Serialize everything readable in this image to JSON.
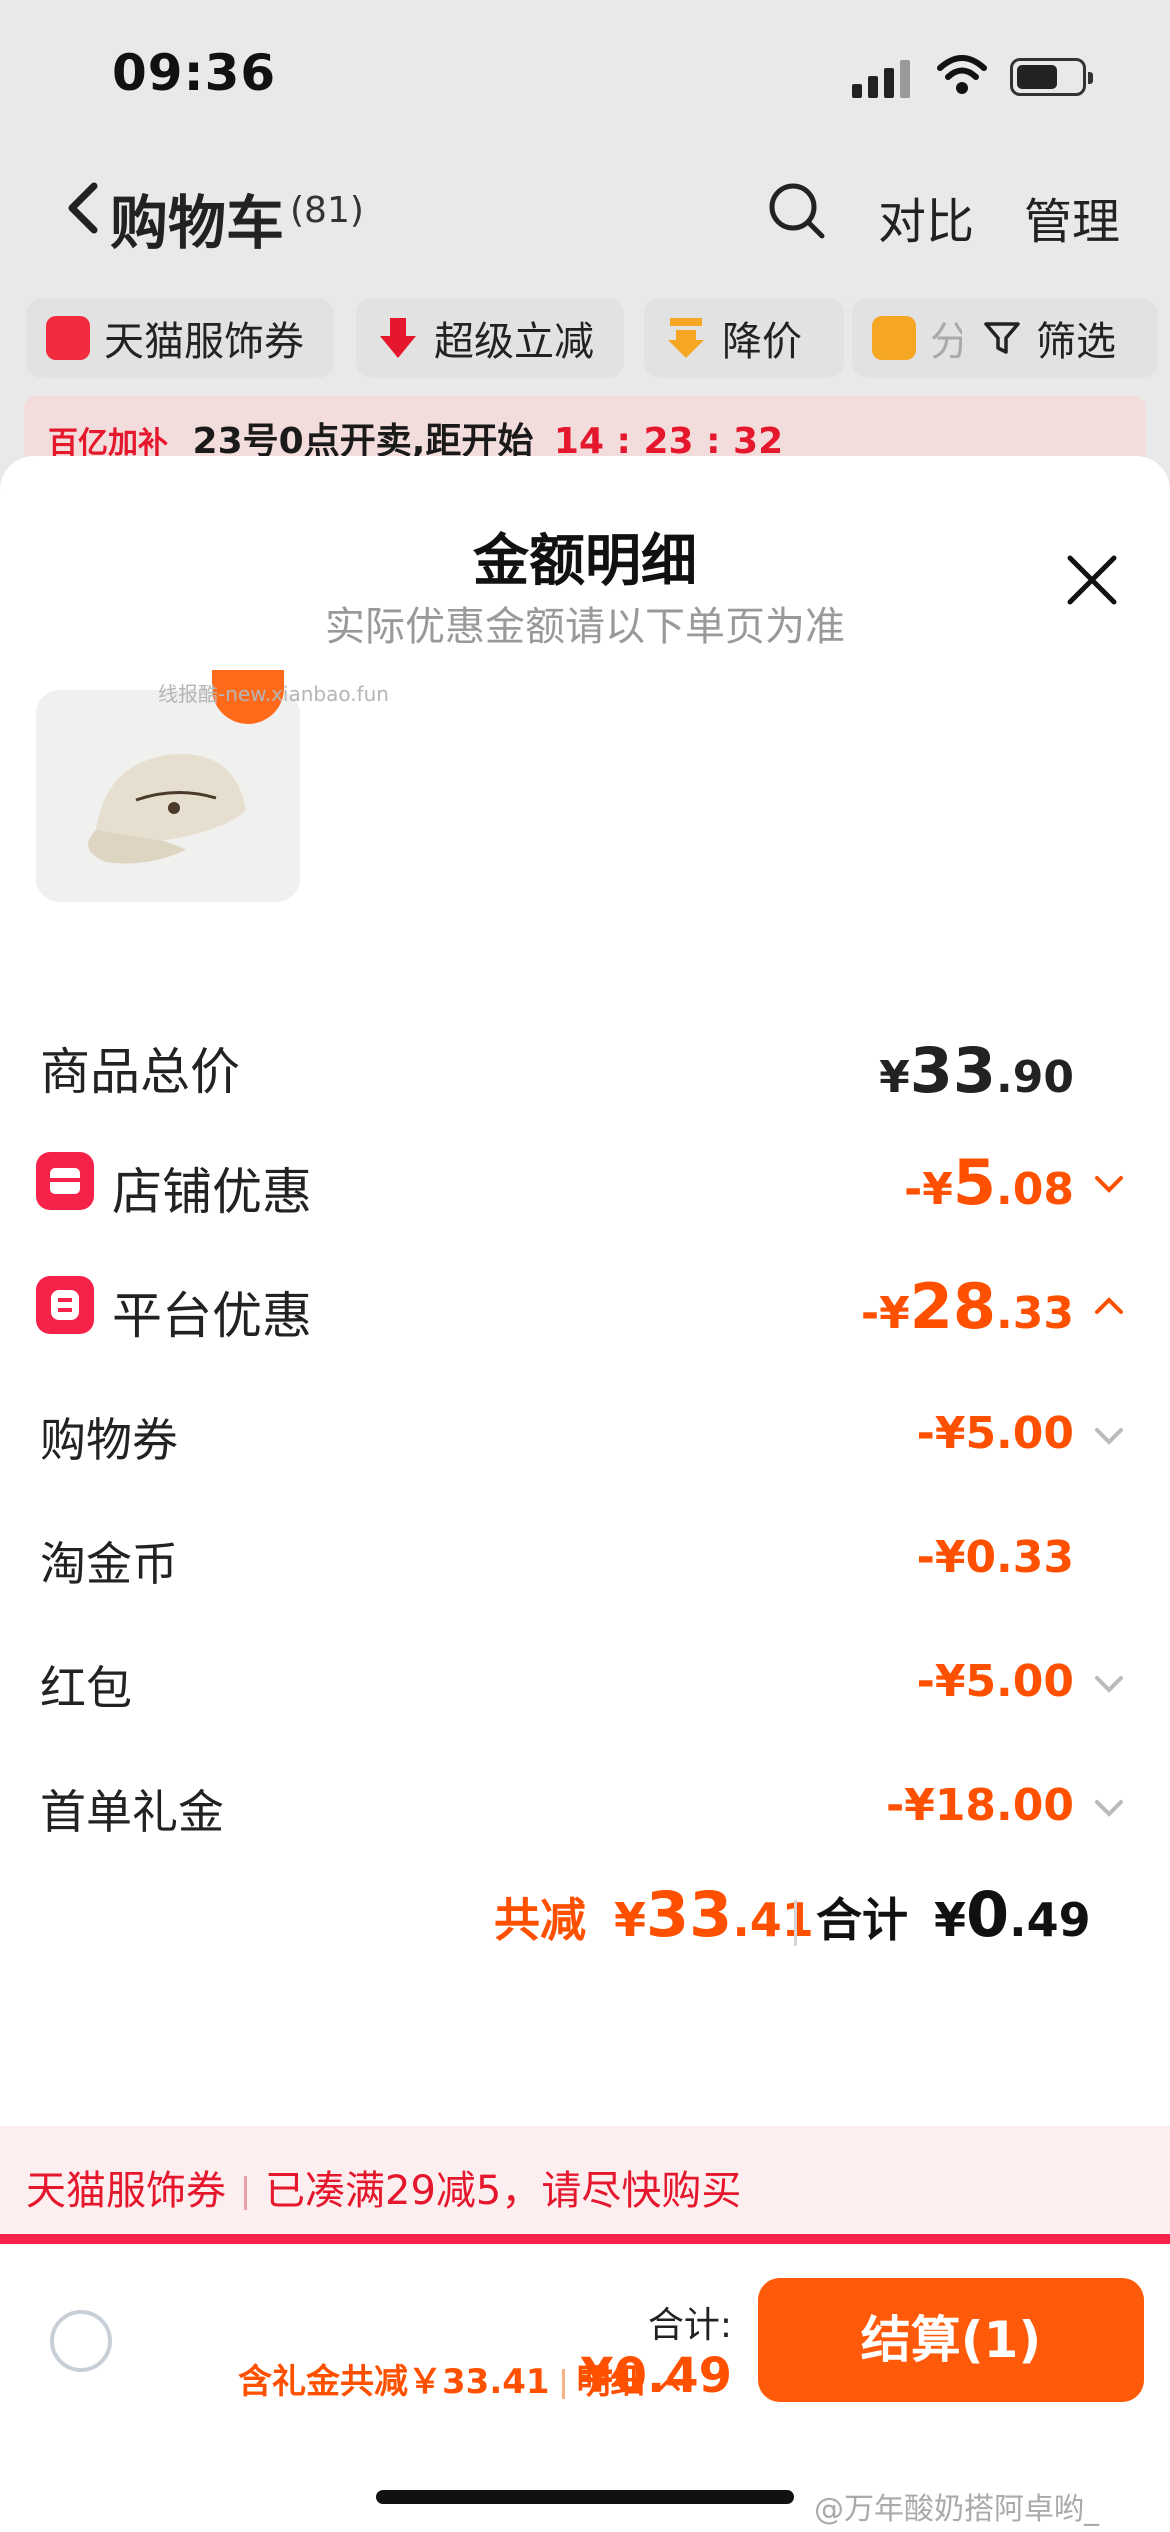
{
  "status_bar": {
    "time": "09:36"
  },
  "nav": {
    "back_icon": "chevron-left-icon",
    "title": "购物车",
    "count": "(81)",
    "search_icon": "search-icon",
    "compare": "对比",
    "manage": "管理"
  },
  "chips": [
    {
      "label": "天猫服饰券",
      "icon": "coupon-icon",
      "color": "#f22b3f"
    },
    {
      "label": "超级立减",
      "icon": "down-arrow-icon",
      "color": "#e5172c"
    },
    {
      "label": "降价",
      "icon": "price-drop-icon",
      "color": "#f5a623"
    },
    {
      "label": "分",
      "icon": "folder-icon",
      "color": "#f5a623"
    }
  ],
  "filter": {
    "label": "筛选",
    "icon": "filter-icon"
  },
  "notice": {
    "tag": "百亿加补",
    "text_a": "23号0点开卖,距开始",
    "countdown": "14 : 23 : 32"
  },
  "sheet": {
    "title": "金额明细",
    "subtitle": "实际优惠金额请以下单页为准",
    "watermark": "线报酷-new.xianbao.fun",
    "rows": {
      "total_price": {
        "label": "商品总价",
        "sym": "¥",
        "int": "33",
        "dec": ".90"
      },
      "store": {
        "label": "店铺优惠",
        "sym": "-¥",
        "int": "5",
        "dec": ".08"
      },
      "platform": {
        "label": "平台优惠",
        "sym": "-¥",
        "int": "28",
        "dec": ".33"
      },
      "coupon": {
        "label": "购物券",
        "value": "-¥5.00"
      },
      "coins": {
        "label": "淘金币",
        "value": "-¥0.33"
      },
      "redpacket": {
        "label": "红包",
        "value": "-¥5.00"
      },
      "first_order": {
        "label": "首单礼金",
        "value": "-¥18.00"
      }
    },
    "summary": {
      "reduce_label": "共减",
      "reduce_sym": "¥",
      "reduce_int": "33",
      "reduce_dec": ".41",
      "total_label": "合计",
      "total_sym": "¥",
      "total_int": "0",
      "total_dec": ".49"
    }
  },
  "promo": {
    "tag": "天猫服饰券",
    "text": "已凑满29减5，请尽快购买"
  },
  "footer": {
    "total_label": "合计:",
    "total_value": "¥0.49",
    "reduce_text": "含礼金共减￥33.41",
    "detail": "明细",
    "checkout": "结算(1)"
  },
  "weibo_credit": "@万年酸奶搭阿卓哟_"
}
